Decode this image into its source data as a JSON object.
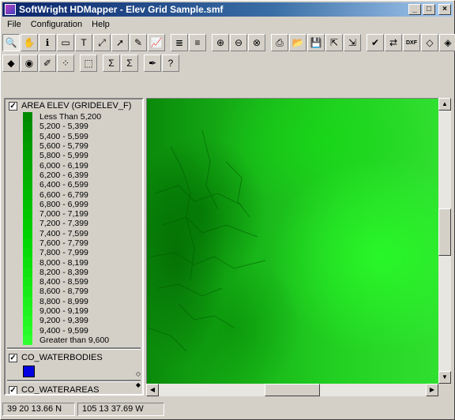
{
  "window": {
    "title": "SoftWright HDMapper - Elev Grid Sample.smf",
    "btn_min": "_",
    "btn_max": "□",
    "btn_close": "×"
  },
  "menu": [
    "File",
    "Configuration",
    "Help"
  ],
  "toolbar1": [
    {
      "name": "zoom-select-icon",
      "glyph": "🔍",
      "pressed": true
    },
    {
      "name": "pan-hand-icon",
      "glyph": "✋"
    },
    {
      "name": "info-icon",
      "glyph": "ℹ"
    },
    {
      "name": "label-icon",
      "glyph": "▭"
    },
    {
      "name": "text-icon",
      "glyph": "T"
    },
    {
      "name": "measure-icon",
      "glyph": "⤢"
    },
    {
      "name": "pointer-icon",
      "glyph": "➚"
    },
    {
      "name": "node-edit-icon",
      "glyph": "✎"
    },
    {
      "name": "profile-icon",
      "glyph": "📈"
    },
    {
      "sep": true
    },
    {
      "name": "layers-icon",
      "glyph": "≣"
    },
    {
      "name": "layers-edit-icon",
      "glyph": "≡"
    },
    {
      "sep": true
    },
    {
      "name": "zoom-in-icon",
      "glyph": "⊕"
    },
    {
      "name": "zoom-out-icon",
      "glyph": "⊖"
    },
    {
      "name": "zoom-cancel-icon",
      "glyph": "⊗"
    },
    {
      "sep": true
    },
    {
      "name": "print-icon",
      "glyph": "⎙"
    },
    {
      "name": "open-folder-icon",
      "glyph": "📂"
    },
    {
      "name": "save-icon",
      "glyph": "💾"
    },
    {
      "name": "export-icon",
      "glyph": "⇱"
    },
    {
      "name": "import-icon",
      "glyph": "⇲"
    },
    {
      "sep": true
    },
    {
      "name": "check-icon",
      "glyph": "✔"
    },
    {
      "name": "convert-icon",
      "glyph": "⇄"
    },
    {
      "name": "dxf-icon",
      "glyph": "DXF"
    },
    {
      "name": "gps-icon",
      "glyph": "◇"
    },
    {
      "name": "color-icon",
      "glyph": "◈"
    }
  ],
  "toolbar2": [
    {
      "name": "add-layer-icon",
      "glyph": "◆"
    },
    {
      "name": "grid-layer-icon",
      "glyph": "◉"
    },
    {
      "name": "edit-layer-icon",
      "glyph": "✐"
    },
    {
      "name": "points-icon",
      "glyph": "⁘"
    },
    {
      "sep": true
    },
    {
      "name": "select-area-icon",
      "glyph": "⬚"
    },
    {
      "sep": true
    },
    {
      "name": "sum-icon",
      "glyph": "Σ"
    },
    {
      "name": "sum-edit-icon",
      "glyph": "Σ"
    },
    {
      "sep": true
    },
    {
      "name": "tools-icon",
      "glyph": "✒"
    },
    {
      "name": "help-icon",
      "glyph": "?"
    }
  ],
  "legend": {
    "layer1": {
      "name": "AREA ELEV (GRIDELEV_F)",
      "checked": "✓"
    },
    "classes": [
      {
        "label": "Less Than 5,200",
        "color": "#008a00"
      },
      {
        "label": "5,200 - 5,399",
        "color": "#009000"
      },
      {
        "label": "5,400 - 5,599",
        "color": "#009600"
      },
      {
        "label": "5,600 - 5,799",
        "color": "#009c00"
      },
      {
        "label": "5,800 - 5,999",
        "color": "#00a200"
      },
      {
        "label": "6,000 - 6,199",
        "color": "#00a800"
      },
      {
        "label": "6,200 - 6,399",
        "color": "#00ae00"
      },
      {
        "label": "6,400 - 6,599",
        "color": "#00b400"
      },
      {
        "label": "6,600 - 6,799",
        "color": "#00ba00"
      },
      {
        "label": "6,800 - 6,999",
        "color": "#00c000"
      },
      {
        "label": "7,000 - 7,199",
        "color": "#00c600"
      },
      {
        "label": "7,200 - 7,399",
        "color": "#00cc00"
      },
      {
        "label": "7,400 - 7,599",
        "color": "#00d200"
      },
      {
        "label": "7,600 - 7,799",
        "color": "#04d804"
      },
      {
        "label": "7,800 - 7,999",
        "color": "#08dc08"
      },
      {
        "label": "8,000 - 8,199",
        "color": "#0ce00c"
      },
      {
        "label": "8,200 - 8,399",
        "color": "#10e410"
      },
      {
        "label": "8,400 - 8,599",
        "color": "#14e814"
      },
      {
        "label": "8,600 - 8,799",
        "color": "#18ec18"
      },
      {
        "label": "8,800 - 8,999",
        "color": "#1cf01c"
      },
      {
        "label": "9,000 - 9,199",
        "color": "#20f420"
      },
      {
        "label": "9,200 - 9,399",
        "color": "#24f824"
      },
      {
        "label": "9,400 - 9,599",
        "color": "#28fc28"
      },
      {
        "label": "Greater than 9,600",
        "color": "#30ff30"
      }
    ],
    "layer2": {
      "name": "CO_WATERBODIES",
      "checked": "✓",
      "color": "#0000e0"
    },
    "layer3": {
      "name": "CO_WATERAREAS",
      "checked": "✓"
    }
  },
  "status": {
    "lat": "39 20 13.66 N",
    "lon": "105 13 37.69 W"
  }
}
